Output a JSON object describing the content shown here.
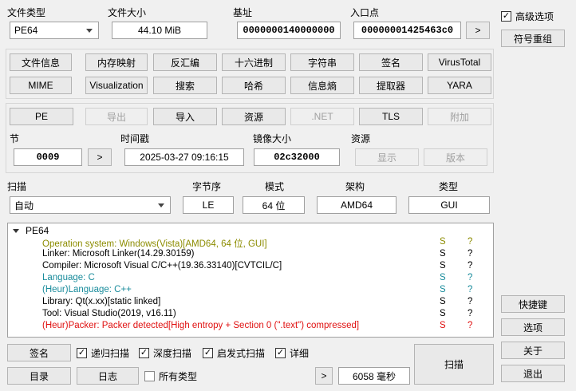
{
  "top": {
    "file_type_label": "文件类型",
    "file_type_value": "PE64",
    "file_size_label": "文件大小",
    "file_size_value": "44.10 MiB",
    "base_label": "基址",
    "base_value": "0000000140000000",
    "entry_label": "入口点",
    "entry_value": "000000014254 63c0",
    "entry_more": ">"
  },
  "right_panel": {
    "advanced_label": "高级选项",
    "advanced_checked": true,
    "symbol_btn": "符号重组",
    "shortcuts_btn": "快捷键",
    "options_btn": "选项",
    "about_btn": "关于",
    "exit_btn": "退出"
  },
  "tools_row1": [
    "文件信息",
    "内存映射",
    "反汇编",
    "十六进制",
    "字符串",
    "签名",
    "VirusTotal"
  ],
  "tools_row2": [
    "MIME",
    "Visualization",
    "搜索",
    "哈希",
    "信息熵",
    "提取器",
    "YARA"
  ],
  "pe_row": {
    "pe": "PE",
    "export": "导出",
    "import": "导入",
    "resources": "资源",
    "net": ".NET",
    "tls": "TLS",
    "overlay": "附加"
  },
  "pe_info": {
    "section_label": "节",
    "section_value": "0009",
    "section_more": ">",
    "timestamp_label": "时间戳",
    "timestamp_value": "2025-03-27 09:16:15",
    "image_size_label": "镜像大小",
    "image_size_value": "02c32000",
    "res_label": "资源",
    "res_show": "显示",
    "res_version": "版本"
  },
  "scan_row": {
    "scan_label": "扫描",
    "scan_value": "自动",
    "endian_label": "字节序",
    "endian_value": "LE",
    "mode_label": "模式",
    "mode_value": "64 位",
    "arch_label": "架构",
    "arch_value": "AMD64",
    "type_label": "类型",
    "type_value": "GUI"
  },
  "results": {
    "root": "PE64",
    "rows": [
      {
        "text": "Operation system: Windows(Vista)[AMD64, 64 位, GUI]",
        "s": "S",
        "q": "?",
        "color": "#8c8c00"
      },
      {
        "text": "Linker: Microsoft Linker(14.29.30159)",
        "s": "S",
        "q": "?",
        "color": "#000000"
      },
      {
        "text": "Compiler: Microsoft Visual C/C++(19.36.33140)[CVTCIL/C]",
        "s": "S",
        "q": "?",
        "color": "#000000"
      },
      {
        "text": "Language: C",
        "s": "S",
        "q": "?",
        "color": "#1a8c9c"
      },
      {
        "text": "(Heur)Language: C++",
        "s": "S",
        "q": "?",
        "color": "#1a8c9c"
      },
      {
        "text": "Library: Qt(x.xx)[static linked]",
        "s": "S",
        "q": "?",
        "color": "#000000"
      },
      {
        "text": "Tool: Visual Studio(2019, v16.11)",
        "s": "S",
        "q": "?",
        "color": "#000000"
      },
      {
        "text": "(Heur)Packer: Packer detected[High entropy + Section 0 (\".text\") compressed]",
        "s": "S",
        "q": "?",
        "color": "#e01010"
      }
    ]
  },
  "bottom": {
    "signatures_btn": "签名",
    "recursive_label": "递归扫描",
    "deep_label": "深度扫描",
    "heuristic_label": "启发式扫描",
    "verbose_label": "详细",
    "directory_btn": "目录",
    "log_btn": "日志",
    "all_types_label": "所有类型",
    "more_btn": ">",
    "time_value": "6058 毫秒",
    "scan_btn": "扫描"
  }
}
